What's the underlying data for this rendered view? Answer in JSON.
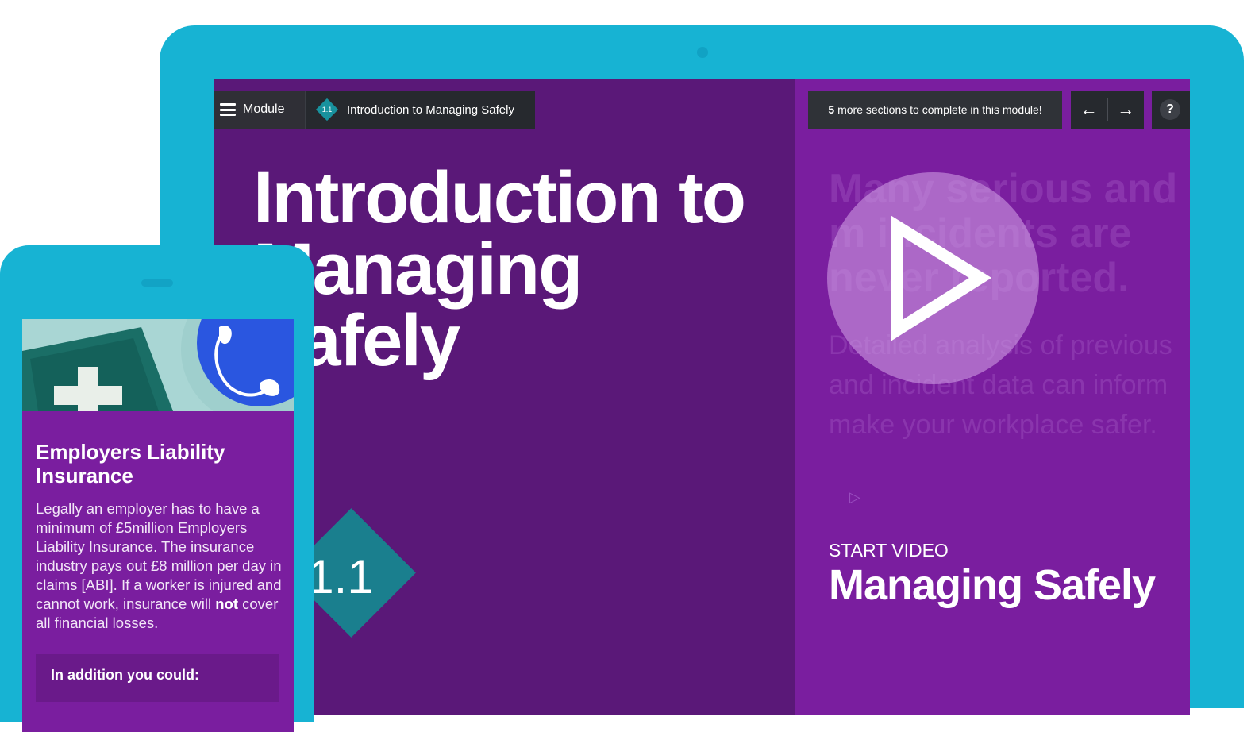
{
  "tablet": {
    "topbar": {
      "module_label": "Module",
      "section_number": "1.1",
      "section_title": "Introduction to Managing Safely",
      "progress_count": "5",
      "progress_text": "more sections to complete in this module!",
      "prev_arrow": "←",
      "next_arrow": "→",
      "help_label": "?"
    },
    "page": {
      "title": "Introduction to Managing Safely",
      "section_badge": "1.1"
    },
    "video": {
      "background_heading": "Many serious and m incidents are never reported.",
      "background_subtext": "Detailed analysis of previous and incident data can inform make your workplace safer.",
      "start_label": "START VIDEO",
      "title": "Managing Safely"
    }
  },
  "phone": {
    "card": {
      "title": "Employers Liability Insurance",
      "body_part1": "Legally an employer has to have a minimum of £5million Employers Liability Insurance. The insurance industry pays out £8 million per day in claims [ABI]. If a worker is injured and cannot work, insurance will ",
      "body_bold": "not",
      "body_part2": " cover all financial losses.",
      "addition_heading": "In addition you could:"
    }
  },
  "colors": {
    "device": "#17b3d3",
    "left_pane": "#5a1878",
    "right_pane": "#7a1e9f",
    "teal_diamond": "#1a7f8e",
    "toolbar": "#26292e"
  },
  "icons": [
    "hamburger-icon",
    "section-diamond-icon",
    "arrow-left-icon",
    "arrow-right-icon",
    "help-icon",
    "play-icon",
    "first-aid-cross-icon",
    "telephone-icon"
  ]
}
